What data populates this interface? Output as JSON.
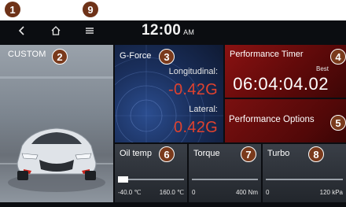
{
  "status_bar": {
    "time": "12:00",
    "ampm": "AM",
    "back_icon": "chevron-left-icon",
    "home_icon": "home-icon",
    "menu_icon": "menu-icon"
  },
  "custom_panel": {
    "label": "CUSTOM"
  },
  "g_force": {
    "title": "G-Force",
    "longitudinal_label": "Longitudinal:",
    "longitudinal_value": "-0.42G",
    "lateral_label": "Lateral:",
    "lateral_value": "0.42G"
  },
  "performance_timer": {
    "title": "Performance Timer",
    "best_label": "Best",
    "time": "06:04:04.02"
  },
  "performance_options": {
    "label": "Performance Options"
  },
  "gauges": [
    {
      "title": "Oil temp",
      "min": "-40.0 ℃",
      "max": "160.0 ℃",
      "level": 0.15
    },
    {
      "title": "Torque",
      "min": "0",
      "max": "400 Nm",
      "level": 0.0
    },
    {
      "title": "Turbo",
      "min": "0",
      "max": "120 kPa",
      "level": 0.0
    }
  ],
  "callouts": [
    "1",
    "2",
    "3",
    "4",
    "5",
    "6",
    "7",
    "8",
    "9"
  ],
  "colors": {
    "background": "#0b0d11",
    "accent_red": "#e0422e",
    "timer_red": "#8a1212",
    "gforce_blue": "#1a2f5c",
    "badge": "#7a3a1c"
  }
}
